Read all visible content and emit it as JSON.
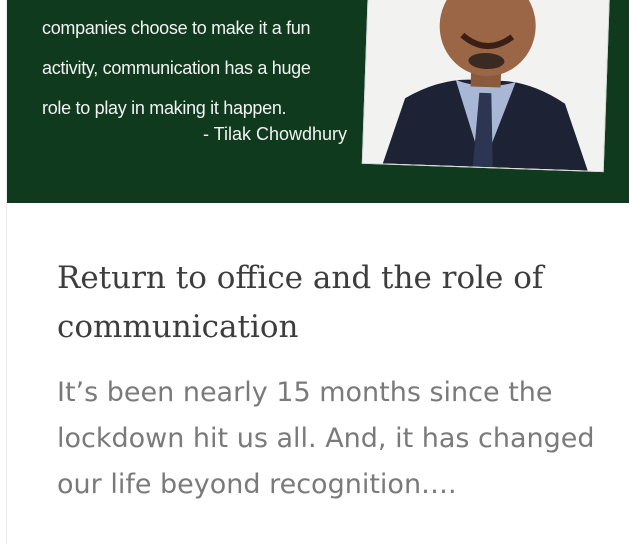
{
  "banner": {
    "quote_lines": [
      "companies  choose to make it a fun",
      "activity, communication  has a huge",
      "role to play in making it happen."
    ],
    "author": "- Tilak Chowdhury",
    "background_color": "#0f3a1d"
  },
  "article": {
    "title": "Return to office and the role of communication",
    "excerpt": "It’s been nearly 15 months since the lockdown hit us all. And, it has changed our life beyond recognition…."
  }
}
